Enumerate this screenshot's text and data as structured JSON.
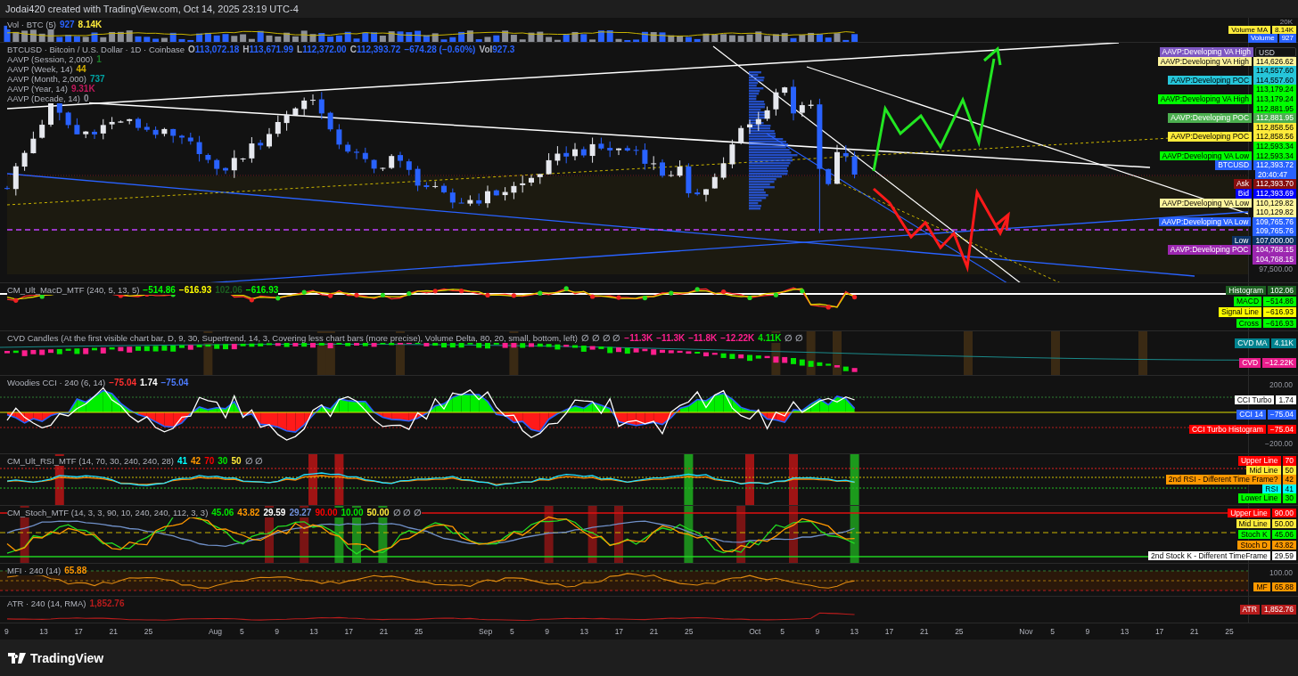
{
  "header": {
    "caption": "Jodai420 created with TradingView.com, Oct 14, 2025 23:19 UTC-4"
  },
  "panes": [
    {
      "kind": "volume",
      "legend": [
        {
          "title": "Vol · BTC (5)",
          "values": [
            {
              "text": "927",
              "color": "#2962ff"
            },
            {
              "text": "8.14K",
              "color": "#ffeb3b"
            }
          ]
        }
      ],
      "axis": [
        {
          "kind": "tick",
          "text": "20K"
        },
        {
          "kind": "label",
          "label": "Volume MA",
          "value": "8.14K",
          "color": "#ffeb3b"
        },
        {
          "kind": "label",
          "label": "Volume",
          "value": "927",
          "color": "#2962ff"
        }
      ]
    },
    {
      "kind": "price",
      "legend": [
        {
          "title": "BTCUSD · Bitcoin / U.S. Dollar · 1D · Coinbase",
          "values": [
            {
              "prefix": "O",
              "text": "113,072.18",
              "color": "#2962ff"
            },
            {
              "prefix": "H",
              "text": "113,671.99",
              "color": "#2962ff"
            },
            {
              "prefix": "L",
              "text": "112,372.00",
              "color": "#2962ff"
            },
            {
              "prefix": "C",
              "text": "112,393.72",
              "color": "#2962ff"
            },
            {
              "text": "−674.28 (−0.60%)",
              "color": "#2962ff"
            },
            {
              "prefix": "Vol",
              "text": "927.3",
              "color": "#2962ff"
            }
          ]
        },
        {
          "title": "AAVP (Session, 2,000)",
          "values": [
            {
              "text": "1",
              "color": "#1b7f2a"
            }
          ]
        },
        {
          "title": "AAVP (Week, 14)",
          "values": [
            {
              "text": "44",
              "color": "#d4b000"
            }
          ]
        },
        {
          "title": "AAVP (Month, 2,000)",
          "values": [
            {
              "text": "737",
              "color": "#00a3a3"
            }
          ]
        },
        {
          "title": "AAVP (Year, 14)",
          "values": [
            {
              "text": "9.31K",
              "color": "#c2185b"
            }
          ]
        },
        {
          "title": "AAVP (Decade, 14)",
          "values": [
            {
              "text": "0",
              "color": "#9598a1"
            }
          ]
        }
      ],
      "axis": [
        {
          "kind": "currency",
          "label": "AAVP:Developing VA High",
          "color": "#7e57c2",
          "value": "USD"
        },
        {
          "kind": "label",
          "label": "AAVP:Developing VA High",
          "value": "114,626.62",
          "color": "#fff59d"
        },
        {
          "kind": "value",
          "value": "114,557.60",
          "color": "#26c6da"
        },
        {
          "kind": "label",
          "label": "AAVP:Developing POC",
          "value": "114,557.60",
          "color": "#26c6da"
        },
        {
          "kind": "value",
          "value": "113,179.24",
          "color": "#00ff00"
        },
        {
          "kind": "label",
          "label": "AAVP:Developing VA High",
          "value": "113,179.24",
          "color": "#00ff00"
        },
        {
          "kind": "value",
          "value": "112,881.95",
          "color": "#00ff00"
        },
        {
          "kind": "label",
          "label": "AAVP:Developing POC",
          "value": "112,881.95",
          "color": "#4caf50"
        },
        {
          "kind": "value",
          "value": "112,858.56",
          "color": "#ffeb3b"
        },
        {
          "kind": "label",
          "label": "AAVP:Developing POC",
          "value": "112,858.56",
          "color": "#ffeb3b"
        },
        {
          "kind": "value",
          "value": "112,593.34",
          "color": "#00ff00"
        },
        {
          "kind": "label",
          "label": "AAVP:Developing VA Low",
          "value": "112,593.34",
          "color": "#00ff00"
        },
        {
          "kind": "label",
          "label": "BTCUSD",
          "value": "112,393.72",
          "color": "#2962ff"
        },
        {
          "kind": "value",
          "value": "20:40:47",
          "color": "#2962ff"
        },
        {
          "kind": "label",
          "label": "Ask",
          "value": "112,393.70",
          "color": "#880e0e"
        },
        {
          "kind": "label",
          "label": "Bid",
          "value": "112,393.69",
          "color": "#0000ff"
        },
        {
          "kind": "label",
          "label": "AAVP:Developing VA Low",
          "value": "110,129.82",
          "color": "#fff59d"
        },
        {
          "kind": "value",
          "value": "110,129.82",
          "color": "#fff59d"
        },
        {
          "kind": "label",
          "label": "AAVP:Developing VA Low",
          "value": "109,765.76",
          "color": "#2962ff"
        },
        {
          "kind": "value",
          "value": "109,765.76",
          "color": "#2962ff"
        },
        {
          "kind": "label",
          "label": "Low",
          "value": "107,000.00",
          "color": "#0c3266"
        },
        {
          "kind": "label",
          "label": "AAVP:Developing POC",
          "value": "104,768.15",
          "color": "#9c27b0"
        },
        {
          "kind": "value",
          "value": "104,768.15",
          "color": "#9c27b0"
        },
        {
          "kind": "tick",
          "text": "97,500.00"
        }
      ]
    },
    {
      "kind": "macd",
      "legend": [
        {
          "title": "CM_Ult_MacD_MTF (240, 5, 13, 5)",
          "values": [
            {
              "text": "−514.86",
              "color": "#00ff00"
            },
            {
              "text": "−616.93",
              "color": "#ffff00"
            },
            {
              "text": "102.06",
              "color": "#1b5e20"
            },
            {
              "text": "−616.93",
              "color": "#00ff00"
            }
          ]
        }
      ],
      "axis": [
        {
          "kind": "label",
          "label": "Histogram",
          "value": "102.06",
          "color": "#1b5e20"
        },
        {
          "kind": "label",
          "label": "MACD",
          "value": "−514.86",
          "color": "#00ff00"
        },
        {
          "kind": "label",
          "label": "Signal Line",
          "value": "−616.93",
          "color": "#ffff00"
        },
        {
          "kind": "label",
          "label": "Cross",
          "value": "−616.93",
          "color": "#00ff00"
        }
      ]
    },
    {
      "kind": "cvd",
      "legend": [
        {
          "title": "CVD Candles (At the first visible chart bar, D, 9, 30, Supertrend, 14, 3, Covering less chart bars (more precise), Volume Delta, 80, 20, small, bottom, left)",
          "values": [
            {
              "text": "∅ ∅ ∅ ∅",
              "color": "#9598a1"
            },
            {
              "text": "−11.3K",
              "color": "#ff1f8e"
            },
            {
              "text": "−11.3K",
              "color": "#ff1f8e"
            },
            {
              "text": "−11.8K",
              "color": "#ff1f8e"
            },
            {
              "text": "−12.22K",
              "color": "#ff1f8e"
            },
            {
              "text": "4.11K",
              "color": "#00e600"
            },
            {
              "text": "∅ ∅",
              "color": "#9598a1"
            }
          ]
        }
      ],
      "axis": [
        {
          "kind": "label",
          "label": "CVD MA",
          "value": "4.11K",
          "color": "#00838f"
        },
        {
          "kind": "label",
          "label": "CVD",
          "value": "−12.22K",
          "color": "#e91e8c"
        }
      ]
    },
    {
      "kind": "cci",
      "legend": [
        {
          "title": "Woodies CCI · 240 (6, 14)",
          "values": [
            {
              "text": "−75.04",
              "color": "#ff3030"
            },
            {
              "text": "1.74",
              "color": "#ffffff"
            },
            {
              "text": "−75.04",
              "color": "#4d7cff"
            }
          ]
        }
      ],
      "axis": [
        {
          "kind": "tick",
          "text": "200.00"
        },
        {
          "kind": "label",
          "label": "CCI Turbo",
          "value": "1.74",
          "color": "#ffffff"
        },
        {
          "kind": "label",
          "label": "CCI 14",
          "value": "−75.04",
          "color": "#2962ff"
        },
        {
          "kind": "label",
          "label": "CCI Turbo Histogram",
          "value": "−75.04",
          "color": "#ff0000"
        },
        {
          "kind": "tick",
          "text": "−200.00"
        }
      ]
    },
    {
      "kind": "rsi",
      "legend": [
        {
          "title": "CM_Ult_RSI_MTF (14, 70, 30, 240, 240, 28)",
          "values": [
            {
              "text": "41",
              "color": "#00ffff"
            },
            {
              "text": "42",
              "color": "#ff9800"
            },
            {
              "text": "70",
              "color": "#ff0000"
            },
            {
              "text": "30",
              "color": "#00e600"
            },
            {
              "text": "50",
              "color": "#ffeb3b"
            },
            {
              "text": "∅ ∅",
              "color": "#9598a1"
            }
          ]
        }
      ],
      "axis": [
        {
          "kind": "label",
          "label": "Upper Line",
          "value": "70",
          "color": "#ff0000"
        },
        {
          "kind": "label",
          "label": "Mid Line",
          "value": "50",
          "color": "#ffeb3b"
        },
        {
          "kind": "label",
          "label": "2nd RSI - Different Time Frame?",
          "value": "42",
          "color": "#ff9800"
        },
        {
          "kind": "label",
          "label": "RSI",
          "value": "41",
          "color": "#00ffff"
        },
        {
          "kind": "label",
          "label": "Lower Line",
          "value": "30",
          "color": "#00ff00"
        }
      ]
    },
    {
      "kind": "stoch",
      "legend": [
        {
          "title": "CM_Stoch_MTF (14, 3, 3, 90, 10, 240, 240, 112, 3, 3)",
          "values": [
            {
              "text": "45.06",
              "color": "#00e600"
            },
            {
              "text": "43.82",
              "color": "#ff9800"
            },
            {
              "text": "29.59",
              "color": "#ffffff"
            },
            {
              "text": "29.27",
              "color": "#6f8fd8"
            },
            {
              "text": "90.00",
              "color": "#ff0000"
            },
            {
              "text": "10.00",
              "color": "#00e600"
            },
            {
              "text": "50.00",
              "color": "#ffeb3b"
            },
            {
              "text": "∅ ∅ ∅",
              "color": "#9598a1"
            }
          ]
        }
      ],
      "axis": [
        {
          "kind": "label",
          "label": "Upper Line",
          "value": "90.00",
          "color": "#ff0000"
        },
        {
          "kind": "label",
          "label": "Mid Line",
          "value": "50.00",
          "color": "#ffeb3b"
        },
        {
          "kind": "label",
          "label": "Stoch K",
          "value": "45.06",
          "color": "#00ff00"
        },
        {
          "kind": "label",
          "label": "Stoch D",
          "value": "43.82",
          "color": "#ff9800"
        },
        {
          "kind": "label",
          "label": "2nd Stock K - Different TimeFrame",
          "value": "29.59",
          "color": "#ffffff"
        }
      ]
    },
    {
      "kind": "mfi",
      "legend": [
        {
          "title": "MFI · 240 (14)",
          "values": [
            {
              "text": "65.88",
              "color": "#ff9800"
            }
          ]
        }
      ],
      "axis": [
        {
          "kind": "tick",
          "text": "100.00"
        },
        {
          "kind": "label",
          "label": "MF",
          "value": "65.88",
          "color": "#ff9800"
        }
      ]
    },
    {
      "kind": "atr",
      "legend": [
        {
          "title": "ATR · 240 (14, RMA)",
          "values": [
            {
              "text": "1,852.76",
              "color": "#b71c1c"
            }
          ]
        }
      ],
      "axis": [
        {
          "kind": "label",
          "label": "ATR",
          "value": "1,852.76",
          "color": "#b71c1c"
        }
      ]
    }
  ],
  "x_axis": {
    "ticks": [
      {
        "kind": "day",
        "text": "9"
      },
      {
        "kind": "day",
        "text": "13"
      },
      {
        "kind": "day",
        "text": "17"
      },
      {
        "kind": "day",
        "text": "21"
      },
      {
        "kind": "day",
        "text": "25"
      },
      {
        "kind": "month",
        "text": "Aug"
      },
      {
        "kind": "day",
        "text": "5"
      },
      {
        "kind": "day",
        "text": "9"
      },
      {
        "kind": "day",
        "text": "13"
      },
      {
        "kind": "day",
        "text": "17"
      },
      {
        "kind": "day",
        "text": "21"
      },
      {
        "kind": "day",
        "text": "25"
      },
      {
        "kind": "month",
        "text": "Sep"
      },
      {
        "kind": "day",
        "text": "5"
      },
      {
        "kind": "day",
        "text": "9"
      },
      {
        "kind": "day",
        "text": "13"
      },
      {
        "kind": "day",
        "text": "17"
      },
      {
        "kind": "day",
        "text": "21"
      },
      {
        "kind": "day",
        "text": "25"
      },
      {
        "kind": "month",
        "text": "Oct"
      },
      {
        "kind": "day",
        "text": "5"
      },
      {
        "kind": "day",
        "text": "9"
      },
      {
        "kind": "day",
        "text": "13"
      },
      {
        "kind": "day",
        "text": "17"
      },
      {
        "kind": "day",
        "text": "21"
      },
      {
        "kind": "day",
        "text": "25"
      },
      {
        "kind": "month",
        "text": "Nov"
      },
      {
        "kind": "day",
        "text": "5"
      },
      {
        "kind": "day",
        "text": "9"
      },
      {
        "kind": "day",
        "text": "13"
      },
      {
        "kind": "day",
        "text": "17"
      },
      {
        "kind": "day",
        "text": "21"
      },
      {
        "kind": "day",
        "text": "25"
      }
    ]
  },
  "footer": {
    "brand": "TradingView"
  }
}
